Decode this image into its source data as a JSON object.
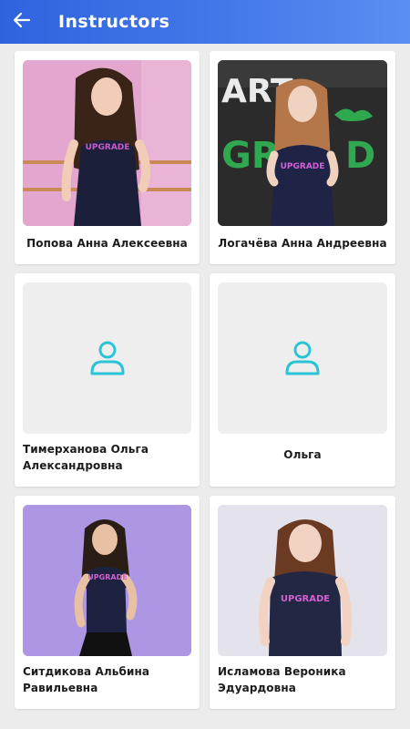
{
  "header": {
    "title": "Instructors",
    "back_icon": "arrow-left-icon",
    "colors": {
      "start": "#2f63de",
      "end": "#5b8ff0"
    }
  },
  "instructors": [
    {
      "name": "Попова Анна Алексеевна",
      "photo": "photo",
      "shirt_text": "UPGRADE"
    },
    {
      "name": "Логачёва Анна Андреевна",
      "photo": "photo",
      "shirt_text": "UPGRADE"
    },
    {
      "name": "Тимерханова Ольга Александровна",
      "photo": "placeholder-user-icon"
    },
    {
      "name": "Ольга",
      "photo": "placeholder-user-icon"
    },
    {
      "name": "Ситдикова Альбина Равильевна",
      "photo": "photo",
      "shirt_text": "UPGRADE"
    },
    {
      "name": "Исламова Вероника Эдуардовна",
      "photo": "photo",
      "shirt_text": "UPGRADE"
    }
  ],
  "colors": {
    "placeholder_icon": "#2bc4d6",
    "photo1_bg": "#d79ac4",
    "photo2_bg": "#2b2b2b",
    "photo5_bg": "#a88fe0",
    "photo6_bg": "#e4e2ea"
  }
}
